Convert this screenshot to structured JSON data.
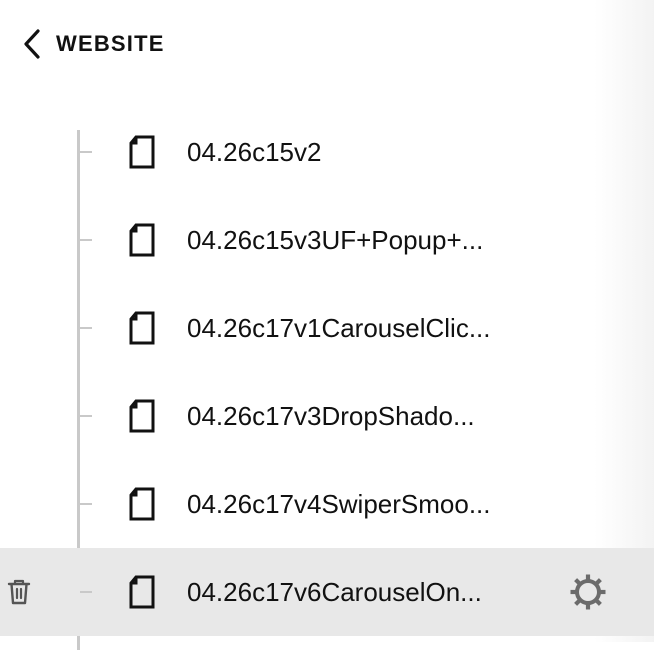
{
  "header": {
    "back_label": "WEBSITE"
  },
  "pages": [
    {
      "label": "04.26c15v2",
      "icon": "page-icon",
      "selected": false
    },
    {
      "label": "04.26c15v3UF+Popup+...",
      "icon": "page-icon",
      "selected": false
    },
    {
      "label": "04.26c17v1CarouselClic...",
      "icon": "page-icon",
      "selected": false
    },
    {
      "label": "04.26c17v3DropShado...",
      "icon": "page-icon",
      "selected": false
    },
    {
      "label": "04.26c17v4SwiperSmoo...",
      "icon": "page-icon",
      "selected": false
    },
    {
      "label": "04.26c17v6CarouselOn...",
      "icon": "page-icon",
      "selected": true
    }
  ],
  "row_actions": {
    "delete_icon": "trash-icon",
    "settings_icon": "gear-icon"
  },
  "colors": {
    "selected_row_bg": "#e8e8e8",
    "tree_line": "#c9c9c9",
    "text": "#111111",
    "icon": "#6b6b6b"
  }
}
